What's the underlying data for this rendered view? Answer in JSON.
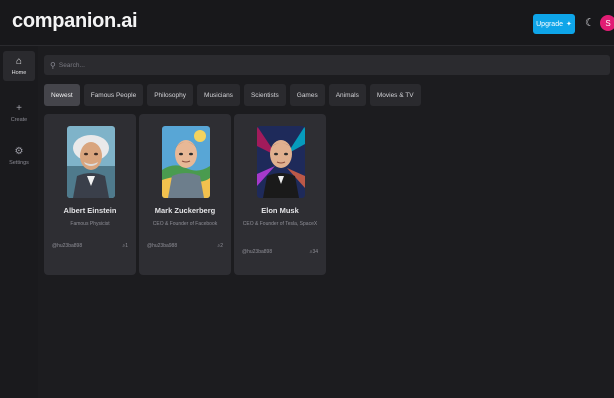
{
  "app": {
    "title": "companion.ai"
  },
  "header": {
    "upgrade_label": "Upgrade",
    "avatar_initial": "S"
  },
  "sidebar": {
    "items": [
      {
        "label": "Home"
      },
      {
        "label": "Create"
      },
      {
        "label": "Settings"
      }
    ]
  },
  "search": {
    "placeholder": "Search..."
  },
  "categories": [
    "Newest",
    "Famous People",
    "Philosophy",
    "Musicians",
    "Scientists",
    "Games",
    "Animals",
    "Movies & TV"
  ],
  "companions": [
    {
      "name": "Albert Einstein",
      "description": "Famous Physicist",
      "author": "@hu23ba898",
      "messages": "1"
    },
    {
      "name": "Mark Zuckerberg",
      "description": "CEO & Founder of Facebook",
      "author": "@hu23ba988",
      "messages": "2"
    },
    {
      "name": "Elon Musk",
      "description": "CEO & Founder of Tesla, SpaceX",
      "author": "@hu23ba898",
      "messages": "34"
    }
  ],
  "colors": {
    "accent": "#0ea5e9",
    "avatar": "#e11d74",
    "card": "#2e2e33",
    "background": "#1c1c1f"
  }
}
